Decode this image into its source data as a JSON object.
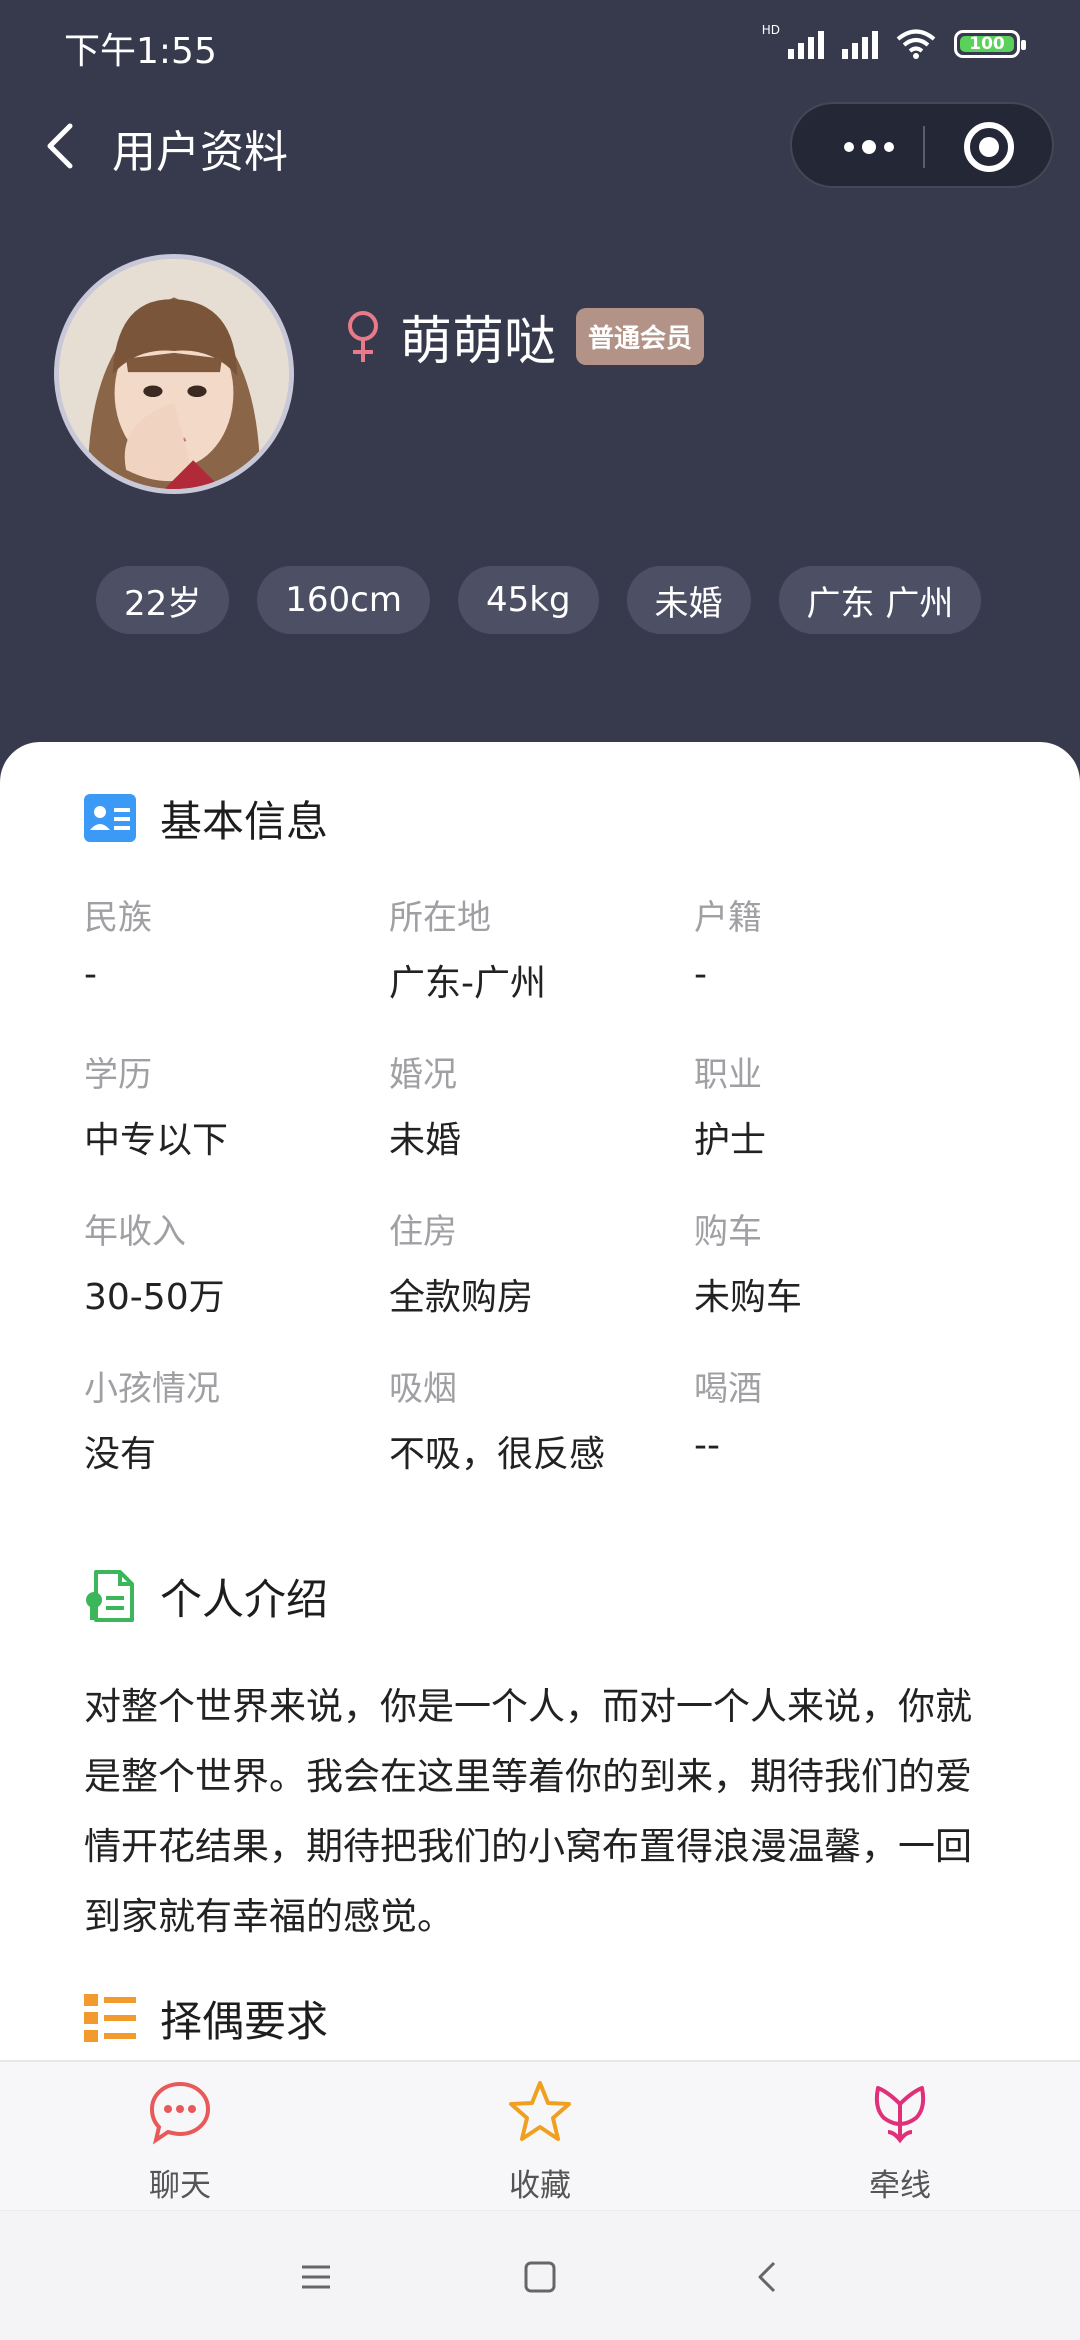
{
  "status_bar": {
    "time": "下午1:55",
    "network_badge": "HD",
    "battery": "100",
    "battery_color": "#5ad15a"
  },
  "navbar": {
    "back_icon": "chevron-left-icon",
    "title": "用户资料",
    "more_icon": "more-dots-icon",
    "close_icon": "target-circle-icon"
  },
  "profile": {
    "gender_icon": "female-icon",
    "nickname": "萌萌哒",
    "member_badge": "普通会员",
    "tags": [
      "22岁",
      "160cm",
      "45kg",
      "未婚",
      "广东 广州"
    ]
  },
  "basic_info": {
    "title": "基本信息",
    "icon": "id-card-icon",
    "rows": [
      [
        {
          "label": "民族",
          "value": "-"
        },
        {
          "label": "所在地",
          "value": "广东-广州"
        },
        {
          "label": "户籍",
          "value": "-"
        }
      ],
      [
        {
          "label": "学历",
          "value": "中专以下"
        },
        {
          "label": "婚况",
          "value": "未婚"
        },
        {
          "label": "职业",
          "value": "护士"
        }
      ],
      [
        {
          "label": "年收入",
          "value": "30-50万"
        },
        {
          "label": "住房",
          "value": "全款购房"
        },
        {
          "label": "购车",
          "value": "未购车"
        }
      ],
      [
        {
          "label": "小孩情况",
          "value": "没有"
        },
        {
          "label": "吸烟",
          "value": "不吸，很反感"
        },
        {
          "label": "喝酒",
          "value": "--"
        }
      ]
    ]
  },
  "intro": {
    "title": "个人介绍",
    "icon": "certificate-document-icon",
    "text": "对整个世界来说，你是一个人，而对一个人来说，你就是整个世界。我会在这里等着你的到来，期待我们的爱情开花结果，期待把我们的小窝布置得浪漫温馨，一回到家就有幸福的感觉。"
  },
  "requirements": {
    "title": "择偶要求",
    "icon": "checklist-icon"
  },
  "tabbar": {
    "items": [
      {
        "label": "聊天",
        "icon": "chat-bubble-icon",
        "color": "#e85a5a"
      },
      {
        "label": "收藏",
        "icon": "star-icon",
        "color": "#f0a020"
      },
      {
        "label": "牵线",
        "icon": "flower-icon",
        "color": "#e0307a"
      }
    ]
  },
  "system_nav": {
    "icons": [
      "menu-icon",
      "home-square-icon",
      "back-arrow-icon"
    ]
  },
  "colors": {
    "header_bg": "#373a4d",
    "tag_bg": "#4d5064",
    "badge_bg": "#b39387",
    "female": "#e87a8a"
  }
}
